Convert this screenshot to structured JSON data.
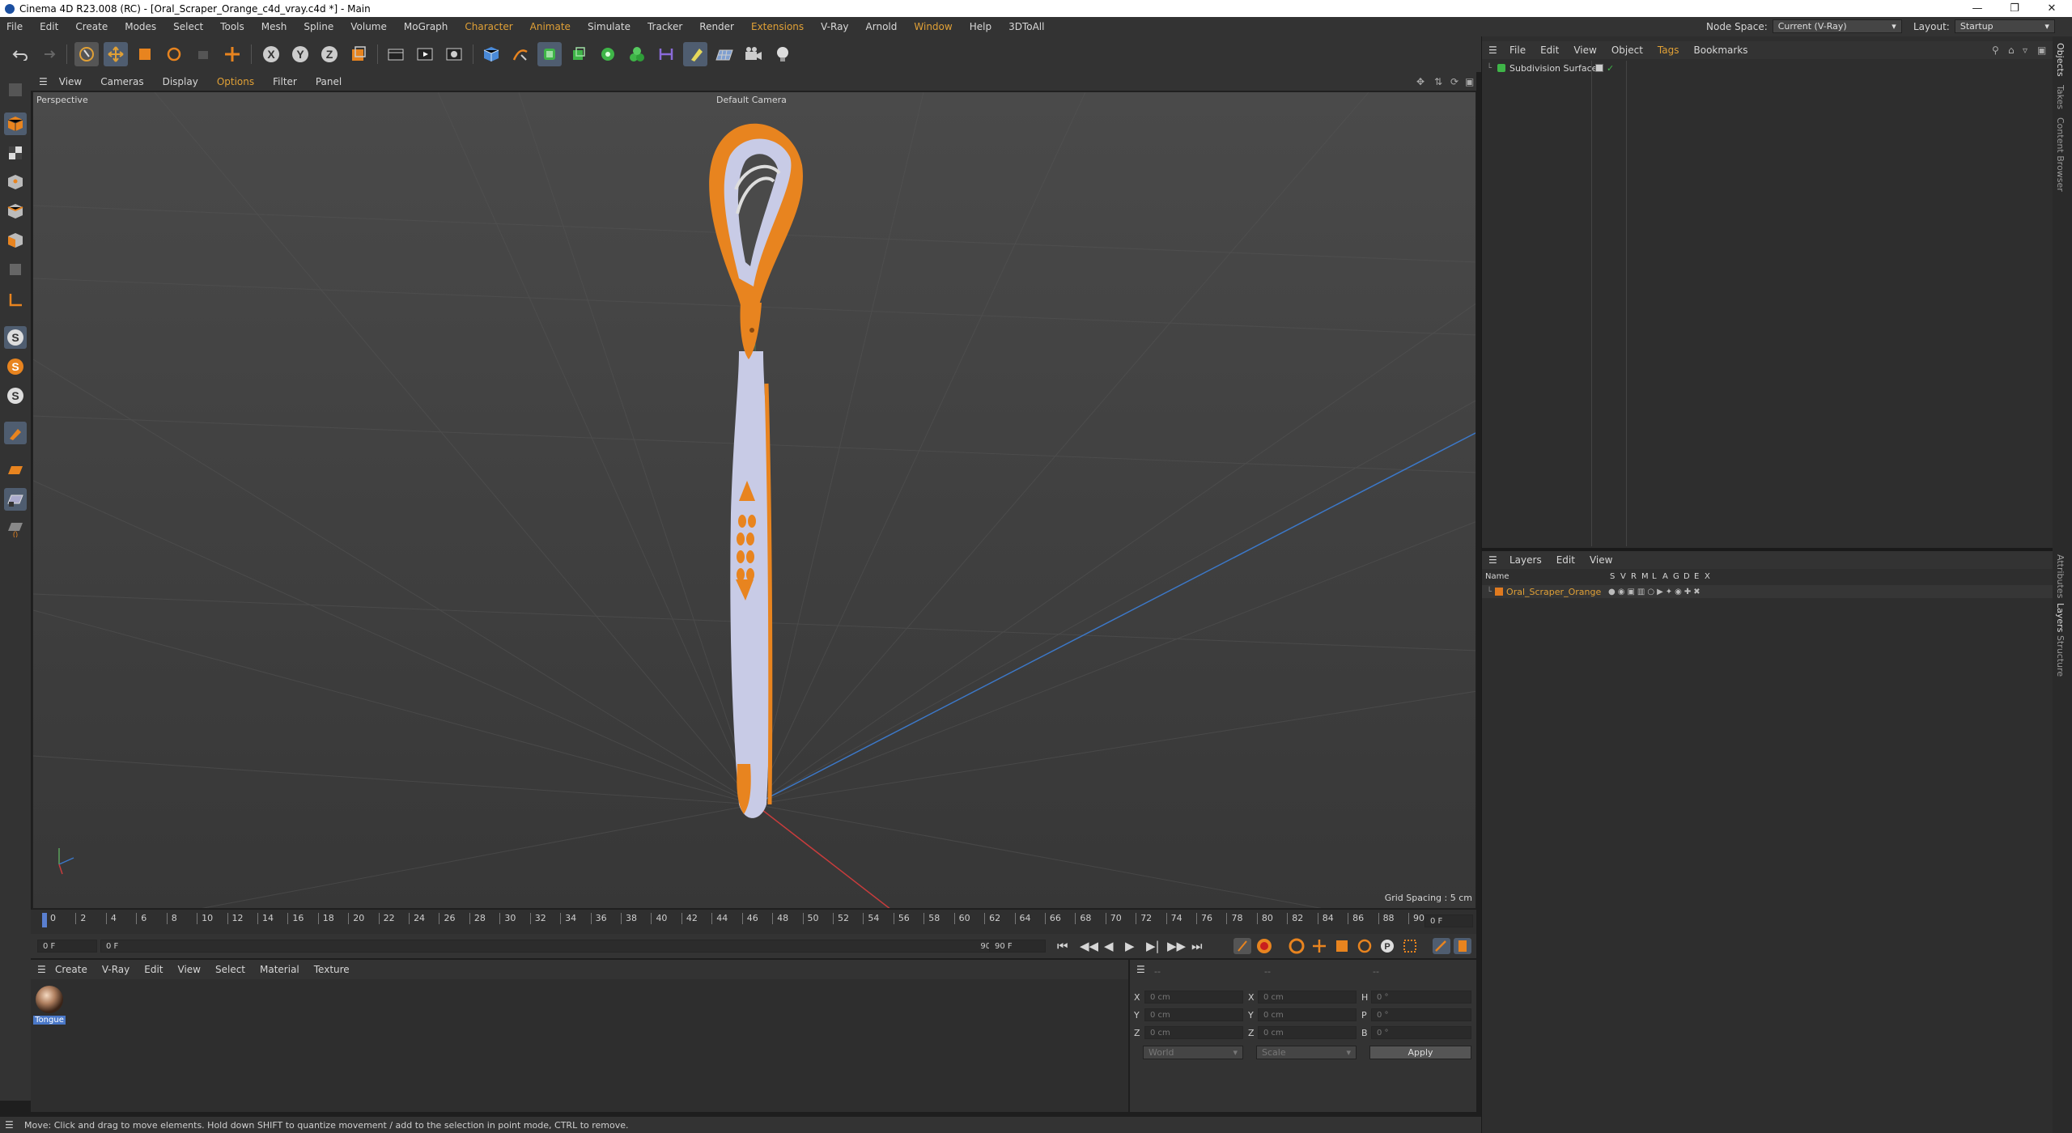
{
  "title_bar": {
    "title": "Cinema 4D R23.008 (RC) - [Oral_Scraper_Orange_c4d_vray.c4d *] - Main"
  },
  "menu": {
    "items": [
      "File",
      "Edit",
      "Create",
      "Modes",
      "Select",
      "Tools",
      "Mesh",
      "Spline",
      "Volume",
      "MoGraph",
      "Character",
      "Animate",
      "Simulate",
      "Tracker",
      "Render",
      "Extensions",
      "V-Ray",
      "Arnold",
      "Window",
      "Help",
      "3DToAll"
    ],
    "node_space_label": "Node Space:",
    "node_space_value": "Current (V-Ray)",
    "layout_label": "Layout:",
    "layout_value": "Startup"
  },
  "viewport": {
    "menu": [
      "View",
      "Cameras",
      "Display",
      "Options",
      "Filter",
      "Panel"
    ],
    "label": "Perspective",
    "camera": "Default Camera",
    "grid_spacing": "Grid Spacing : 5 cm"
  },
  "timeline": {
    "ticks": [
      "0",
      "2",
      "4",
      "6",
      "8",
      "10",
      "12",
      "14",
      "16",
      "18",
      "20",
      "22",
      "24",
      "26",
      "28",
      "30",
      "32",
      "34",
      "36",
      "38",
      "40",
      "42",
      "44",
      "46",
      "48",
      "50",
      "52",
      "54",
      "56",
      "58",
      "60",
      "62",
      "64",
      "66",
      "68",
      "70",
      "72",
      "74",
      "76",
      "78",
      "80",
      "82",
      "84",
      "86",
      "88",
      "90"
    ],
    "end_frame": "0 F",
    "current_frame": "0 F",
    "min_frame": "0 F",
    "max_frame_a": "90 F",
    "max_frame_b": "90 F"
  },
  "materials": {
    "menu": [
      "Create",
      "V-Ray",
      "Edit",
      "View",
      "Select",
      "Material",
      "Texture"
    ],
    "items": [
      {
        "name": "Tongue"
      }
    ]
  },
  "coordinates": {
    "header_a": "--",
    "header_b": "--",
    "header_c": "--",
    "rows": [
      {
        "a": "X",
        "a_val": "0 cm",
        "b": "X",
        "b_val": "0 cm",
        "c": "H",
        "c_val": "0 °"
      },
      {
        "a": "Y",
        "a_val": "0 cm",
        "b": "Y",
        "b_val": "0 cm",
        "c": "P",
        "c_val": "0 °"
      },
      {
        "a": "Z",
        "a_val": "0 cm",
        "b": "Z",
        "b_val": "0 cm",
        "c": "B",
        "c_val": "0 °"
      }
    ],
    "world": "World",
    "scale": "Scale",
    "apply": "Apply"
  },
  "objects_panel": {
    "menu": [
      "File",
      "Edit",
      "View",
      "Object",
      "Tags",
      "Bookmarks"
    ],
    "objects": [
      {
        "name": "Subdivision Surface"
      }
    ]
  },
  "layers_panel": {
    "menu": [
      "Layers",
      "Edit",
      "View"
    ],
    "header_name": "Name",
    "columns": [
      "S",
      "V",
      "R",
      "M",
      "L",
      "A",
      "G",
      "D",
      "E",
      "X"
    ],
    "layers": [
      {
        "name": "Oral_Scraper_Orange",
        "color": "#e07a1f"
      }
    ]
  },
  "side_tabs": [
    "Objects",
    "Takes",
    "Content Browser",
    "Attributes",
    "Layers",
    "Structure"
  ],
  "status": "Move: Click and drag to move elements. Hold down SHIFT to quantize movement / add to the selection in point mode, CTRL to remove.",
  "colors": {
    "accent": "#e0a036",
    "object_orange": "#e8841f",
    "object_body": "#c8cbe6",
    "selection_blue": "#4a78c8"
  }
}
